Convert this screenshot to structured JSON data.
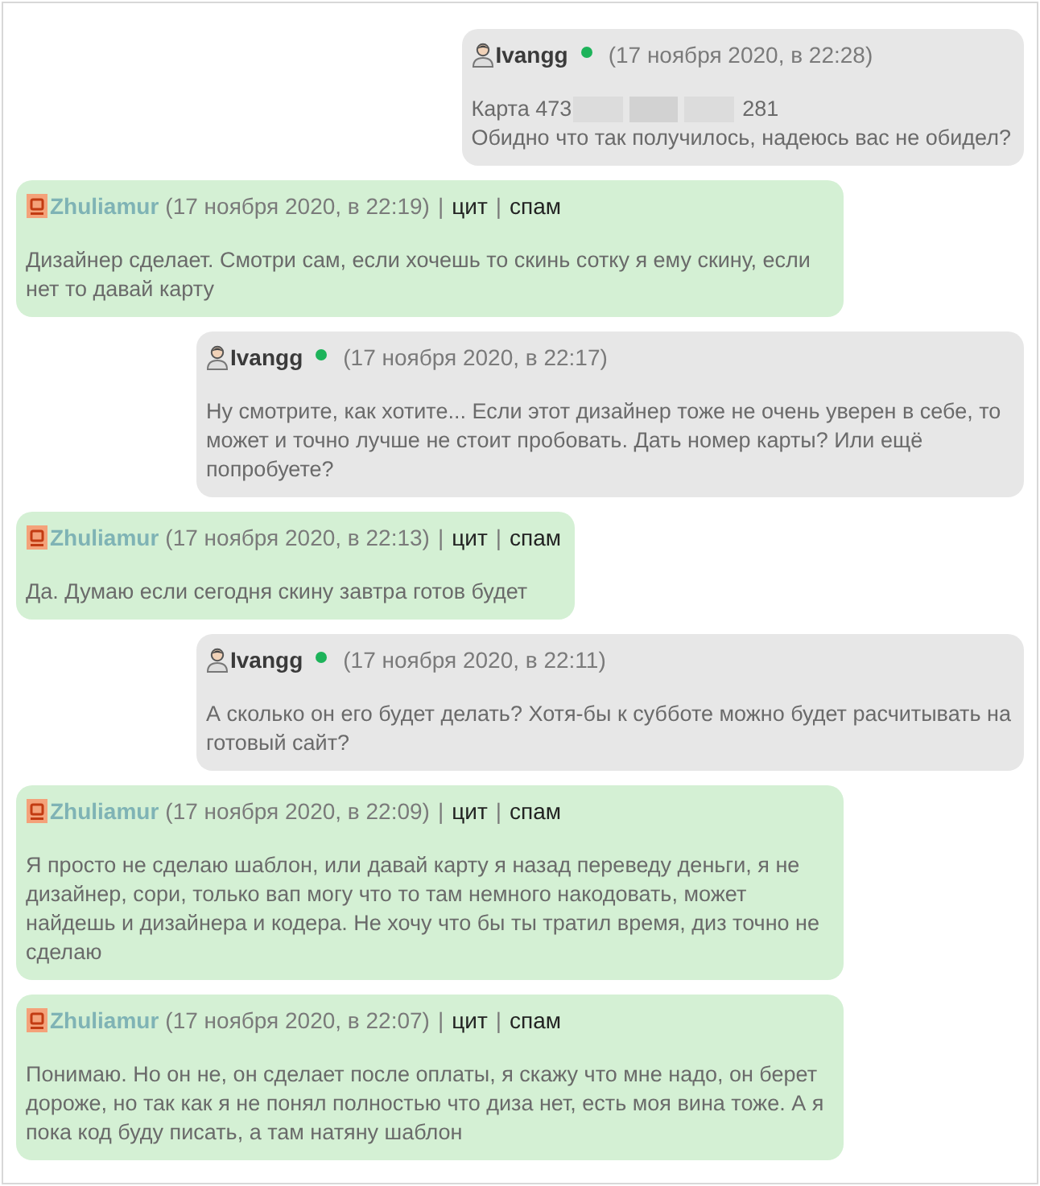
{
  "messages": [
    {
      "kind": "outgoing",
      "author": "Ivangg",
      "online": true,
      "time": "(17 ноября 2020, в 22:28)",
      "body": [
        {
          "kind": "card",
          "prefix": "Карта 473",
          "suffix": "281"
        },
        {
          "kind": "text",
          "text": "Обидно что так получилось, надеюсь вас не обидел?"
        }
      ]
    },
    {
      "kind": "incoming",
      "author": "Zhuliamur",
      "time": "(17 ноября 2020, в 22:19)",
      "links": [
        {
          "separator": "|",
          "label": "цит"
        },
        {
          "separator": "|",
          "label": "спам"
        }
      ],
      "body": [
        {
          "kind": "text",
          "text": "Дизайнер сделает. Смотри сам, если хочешь то скинь сотку я ему скину, если нет то давай карту"
        }
      ]
    },
    {
      "kind": "outgoing",
      "author": "Ivangg",
      "online": true,
      "time": "(17 ноября 2020, в 22:17)",
      "body": [
        {
          "kind": "text",
          "text": "Ну смотрите, как хотите... Если этот дизайнер тоже не очень уверен в себе, то может и точно лучше не стоит пробовать. Дать номер карты? Или ещё попробуете?"
        }
      ]
    },
    {
      "kind": "incoming",
      "author": "Zhuliamur",
      "time": "(17 ноября 2020, в 22:13)",
      "links": [
        {
          "separator": "|",
          "label": "цит"
        },
        {
          "separator": "|",
          "label": "спам"
        }
      ],
      "body": [
        {
          "kind": "text",
          "text": "Да. Думаю если сегодня скину завтра готов будет"
        }
      ]
    },
    {
      "kind": "outgoing",
      "author": "Ivangg",
      "online": true,
      "time": "(17 ноября 2020, в 22:11)",
      "body": [
        {
          "kind": "text",
          "text": "А сколько он его будет делать? Хотя-бы к субботе можно будет расчитывать на готовый сайт?"
        }
      ]
    },
    {
      "kind": "incoming",
      "author": "Zhuliamur",
      "time": "(17 ноября 2020, в 22:09)",
      "links": [
        {
          "separator": "|",
          "label": "цит"
        },
        {
          "separator": "|",
          "label": "спам"
        }
      ],
      "body": [
        {
          "kind": "text",
          "text": "Я просто не сделаю шаблон, или давай карту я назад переведу деньги, я не дизайнер, сори, только вап могу что то там немного накодовать, может найдешь и дизайнера и кодера. Не хочу что бы ты тратил время, диз точно не сделаю"
        }
      ]
    },
    {
      "kind": "incoming",
      "author": "Zhuliamur",
      "time": "(17 ноября 2020, в 22:07)",
      "links": [
        {
          "separator": "|",
          "label": "цит"
        },
        {
          "separator": "|",
          "label": "спам"
        }
      ],
      "body": [
        {
          "kind": "text",
          "text": "Понимаю. Но он не, он сделает после оплаты, я скажу что мне надо, он берет дороже, но так как я не понял полностью что диза нет, есть моя вина тоже. А я пока код буду писать, а там натяну шаблон"
        }
      ]
    }
  ]
}
